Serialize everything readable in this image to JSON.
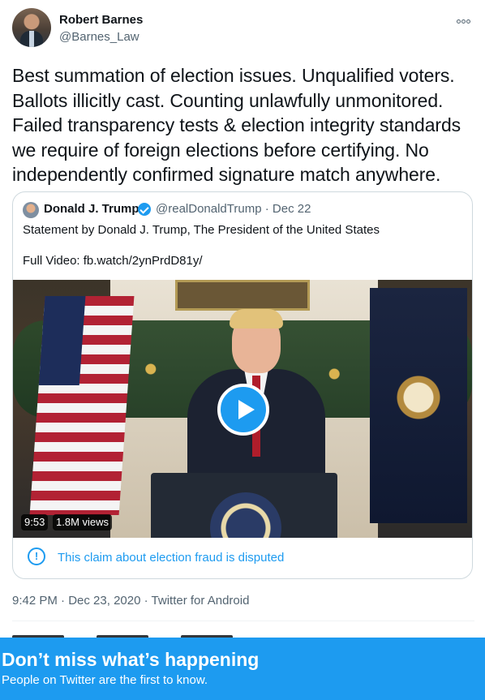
{
  "tweet": {
    "author_name": "Robert Barnes",
    "author_handle": "@Barnes_Law",
    "text": "Best summation of election issues. Unqualified voters. Ballots illicitly cast. Counting unlawfully unmonitored. Failed transparency tests & election integrity standards we require of foreign elections before certifying. No independently confirmed signature match anywhere.",
    "time": "9:42 PM",
    "date": "Dec 23, 2020",
    "source": "Twitter for Android",
    "separator": "·"
  },
  "quote": {
    "author_name": "Donald J. Trump",
    "author_handle": "@realDonaldTrump",
    "date": "Dec 22",
    "text_line1": "Statement by Donald J. Trump, The President of the United States",
    "text_line2": "Full Video: fb.watch/2ynPrdD81y/",
    "video": {
      "duration": "9:53",
      "views": "1.8M views"
    },
    "disputed_notice": "This claim about election fraud is disputed"
  },
  "banner": {
    "title": "Don’t miss what’s happening",
    "subtitle": "People on Twitter are the first to know."
  },
  "colors": {
    "accent": "#1d9bf0",
    "text": "#0f1419",
    "muted": "#536471",
    "border": "#cfd9de"
  },
  "icons": [
    "more-icon",
    "verified-icon",
    "play-icon",
    "info-icon"
  ]
}
